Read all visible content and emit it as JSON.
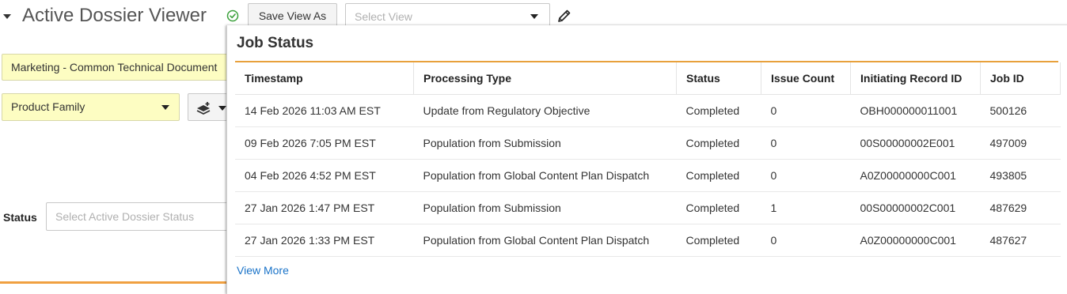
{
  "header": {
    "title": "Active Dossier Viewer",
    "save_view_label": "Save View As",
    "select_view_placeholder": "Select View"
  },
  "filters": {
    "marketing_chip": "Marketing - Common Technical Document",
    "product_family": "Product Family",
    "status_label": "Status",
    "status_placeholder": "Select Active Dossier Status"
  },
  "job_status": {
    "title": "Job Status",
    "columns": [
      "Timestamp",
      "Processing Type",
      "Status",
      "Issue Count",
      "Initiating Record ID",
      "Job ID"
    ],
    "rows": [
      [
        "14 Feb 2026 11:03 AM EST",
        "Update from Regulatory Objective",
        "Completed",
        "0",
        "OBH000000011001",
        "500126"
      ],
      [
        "09 Feb 2026 7:05 PM EST",
        "Population from Submission",
        "Completed",
        "0",
        "00S00000002E001",
        "497009"
      ],
      [
        "04 Feb 2026 4:52 PM EST",
        "Population from Global Content Plan Dispatch",
        "Completed",
        "0",
        "A0Z00000000C001",
        "493805"
      ],
      [
        "27 Jan 2026 1:47 PM EST",
        "Population from Submission",
        "Completed",
        "1",
        "00S00000002C001",
        "487629"
      ],
      [
        "27 Jan 2026 1:33 PM EST",
        "Population from Global Content Plan Dispatch",
        "Completed",
        "0",
        "A0Z00000000C001",
        "487627"
      ]
    ],
    "view_more_label": "View More"
  },
  "icons": {
    "collapse": "caret-down-icon",
    "saved_state": "check-circle-icon",
    "edit": "pencil-icon",
    "layers": "layers-add-icon"
  },
  "colors": {
    "accent_orange": "#e8a13c",
    "highlight_yellow": "#fdfdc2",
    "link_blue": "#1a73c8",
    "success_green": "#3aa03a"
  }
}
